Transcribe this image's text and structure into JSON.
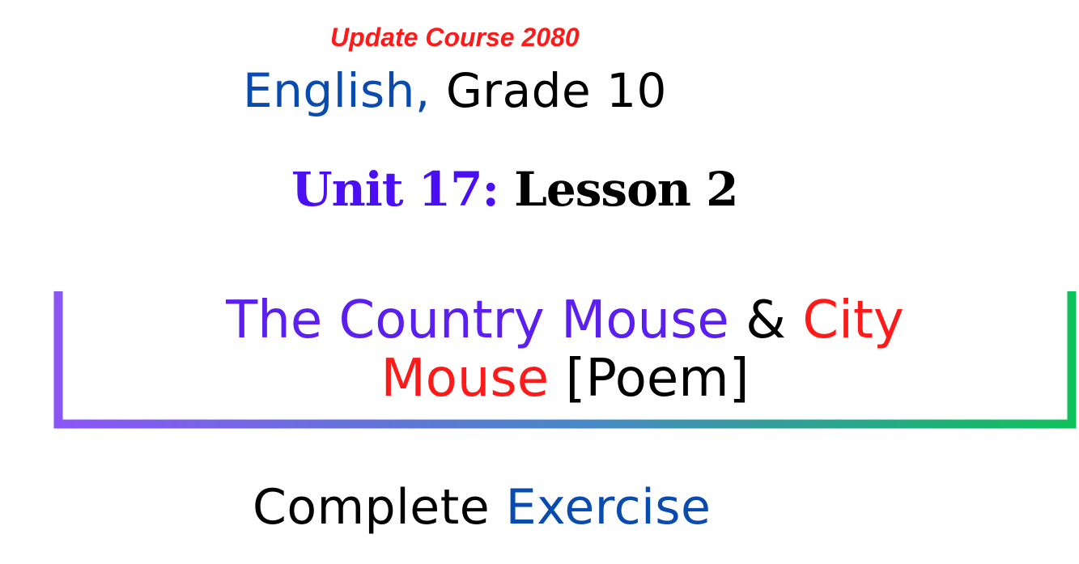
{
  "colors": {
    "red": "#ff1a1a",
    "blue": "#0a4bb0",
    "violet": "#4a0ff2",
    "purple_title": "#5b1ff0",
    "black": "#000000",
    "frame_start": "#8b55f6",
    "frame_end": "#0fc15b"
  },
  "header": {
    "tagline": "Update Course 2080",
    "subject": "English,",
    "grade": "Grade 10"
  },
  "unit": {
    "unit_label": "Unit 17:",
    "lesson_label": "Lesson 2"
  },
  "title": {
    "part1": "The Country Mouse",
    "amp": "&",
    "part2": "City",
    "part3": "Mouse",
    "part4": "[Poem]"
  },
  "footer": {
    "word1": "Complete",
    "word2": "Exercise"
  }
}
